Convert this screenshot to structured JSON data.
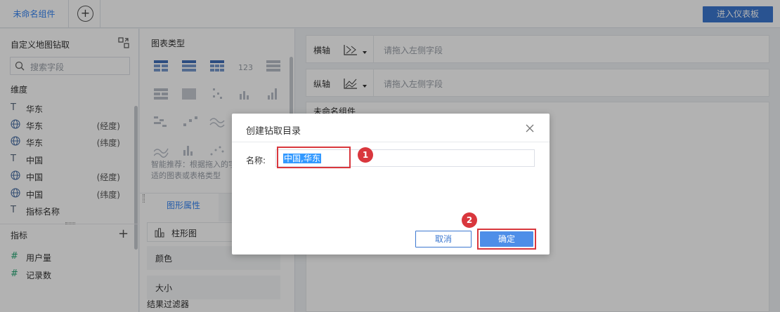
{
  "topbar": {
    "tab_label": "未命名组件",
    "add_tab_symbol": "+",
    "enter_dashboard_label": "进入仪表板"
  },
  "left_panel": {
    "title": "自定义地图钻取",
    "search_placeholder": "搜索字段",
    "dimension_label": "维度",
    "dimensions": [
      {
        "icon": "text-type-icon",
        "glyph": "T",
        "name": "华东",
        "suffix": ""
      },
      {
        "icon": "globe-icon",
        "glyph": "🌐",
        "name": "华东",
        "suffix": "(经度)"
      },
      {
        "icon": "globe-icon",
        "glyph": "🌐",
        "name": "华东",
        "suffix": "(纬度)"
      },
      {
        "icon": "text-type-icon",
        "glyph": "T",
        "name": "中国",
        "suffix": ""
      },
      {
        "icon": "globe-icon",
        "glyph": "🌐",
        "name": "中国",
        "suffix": "(经度)"
      },
      {
        "icon": "globe-icon",
        "glyph": "🌐",
        "name": "中国",
        "suffix": "(纬度)"
      },
      {
        "icon": "text-type-icon",
        "glyph": "T",
        "name": "指标名称",
        "suffix": ""
      }
    ],
    "measure_label": "指标",
    "measures": [
      {
        "icon": "number-icon",
        "glyph": "#",
        "name": "用户量"
      },
      {
        "icon": "number-calc-icon",
        "glyph": "#",
        "name": "记录数"
      }
    ]
  },
  "mid_panel": {
    "chart_type_title": "图表类型",
    "hint_text": "智能推荐：根据拖入的字段自动推荐合适的图表或表格类型",
    "tab_shape_label": "图形属性",
    "shape_type_label": "柱形图",
    "color_label": "颜色",
    "size_label": "大小",
    "result_filter_label": "结果过滤器"
  },
  "right_area": {
    "x_axis_label": "横轴",
    "y_axis_label": "纵轴",
    "axis_placeholder": "请拖入左侧字段",
    "canvas_title": "未命名组件"
  },
  "dialog": {
    "title": "创建钻取目录",
    "name_label": "名称:",
    "name_value": "中国,华东",
    "cancel_label": "取消",
    "ok_label": "确定",
    "badge_1": "1",
    "badge_2": "2",
    "highlight_color": "#d9373d"
  },
  "colors": {
    "accent": "#3685f2",
    "primary_button": "#3c78d0"
  }
}
